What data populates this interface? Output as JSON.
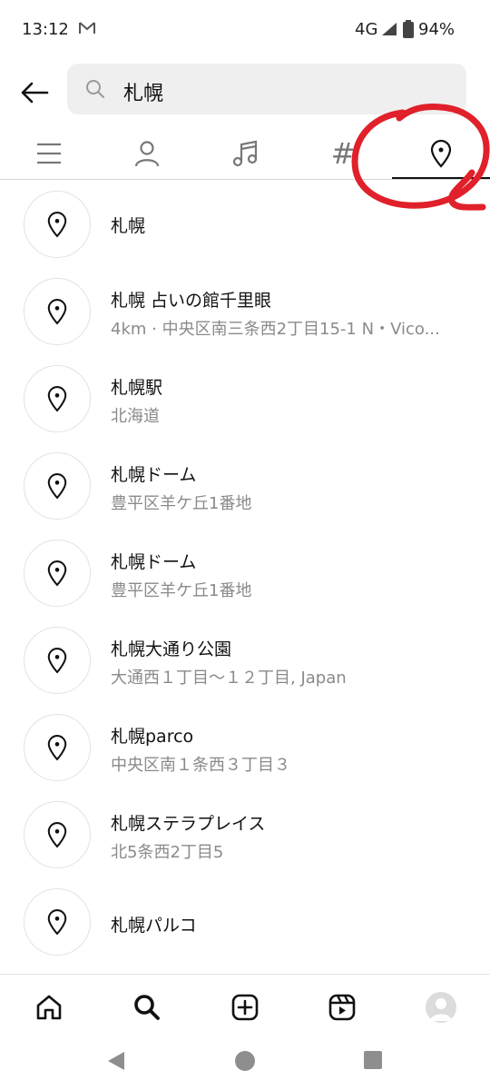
{
  "status_bar": {
    "time": "13:12",
    "network": "4G",
    "battery_pct": "94%",
    "icons": [
      "gmail-icon",
      "signal-icon",
      "battery-icon"
    ]
  },
  "header": {
    "back_icon": "arrow-left-icon",
    "search_icon": "search-icon",
    "query": "札幌"
  },
  "tabs": [
    {
      "name": "top",
      "icon": "menu-lines-icon"
    },
    {
      "name": "accounts",
      "icon": "person-icon"
    },
    {
      "name": "audio",
      "icon": "music-note-icon"
    },
    {
      "name": "tags",
      "icon": "hashtag-icon",
      "glyph": "#"
    },
    {
      "name": "places",
      "icon": "location-pin-icon",
      "active": true
    }
  ],
  "annotation": {
    "color": "#e0202a",
    "shape": "hand-drawn-circle"
  },
  "results": [
    {
      "title": "札幌",
      "subtitle": ""
    },
    {
      "title": "札幌 占いの館千里眼",
      "subtitle": "4km · 中央区南三条西2丁目15-1 N・Vico..."
    },
    {
      "title": "札幌駅",
      "subtitle": "北海道"
    },
    {
      "title": "札幌ドーム",
      "subtitle": "豊平区羊ケ丘1番地"
    },
    {
      "title": "札幌ドーム",
      "subtitle": "豊平区羊ケ丘1番地"
    },
    {
      "title": "札幌大通り公園",
      "subtitle": "大通西１丁目〜１２丁目, Japan"
    },
    {
      "title": "札幌parco",
      "subtitle": "中央区南１条西３丁目３"
    },
    {
      "title": "札幌ステラプレイス",
      "subtitle": "北5条西2丁目5"
    },
    {
      "title": "札幌パルコ",
      "subtitle": ""
    }
  ],
  "bottom_nav": [
    "home-icon",
    "search-icon",
    "create-icon",
    "reels-icon",
    "profile-avatar"
  ],
  "system_nav": [
    "back-triangle-icon",
    "home-circle-icon",
    "recents-square-icon"
  ],
  "colors": {
    "text": "#111111",
    "secondary": "#8a8a8a",
    "search_bg": "#efefef"
  }
}
